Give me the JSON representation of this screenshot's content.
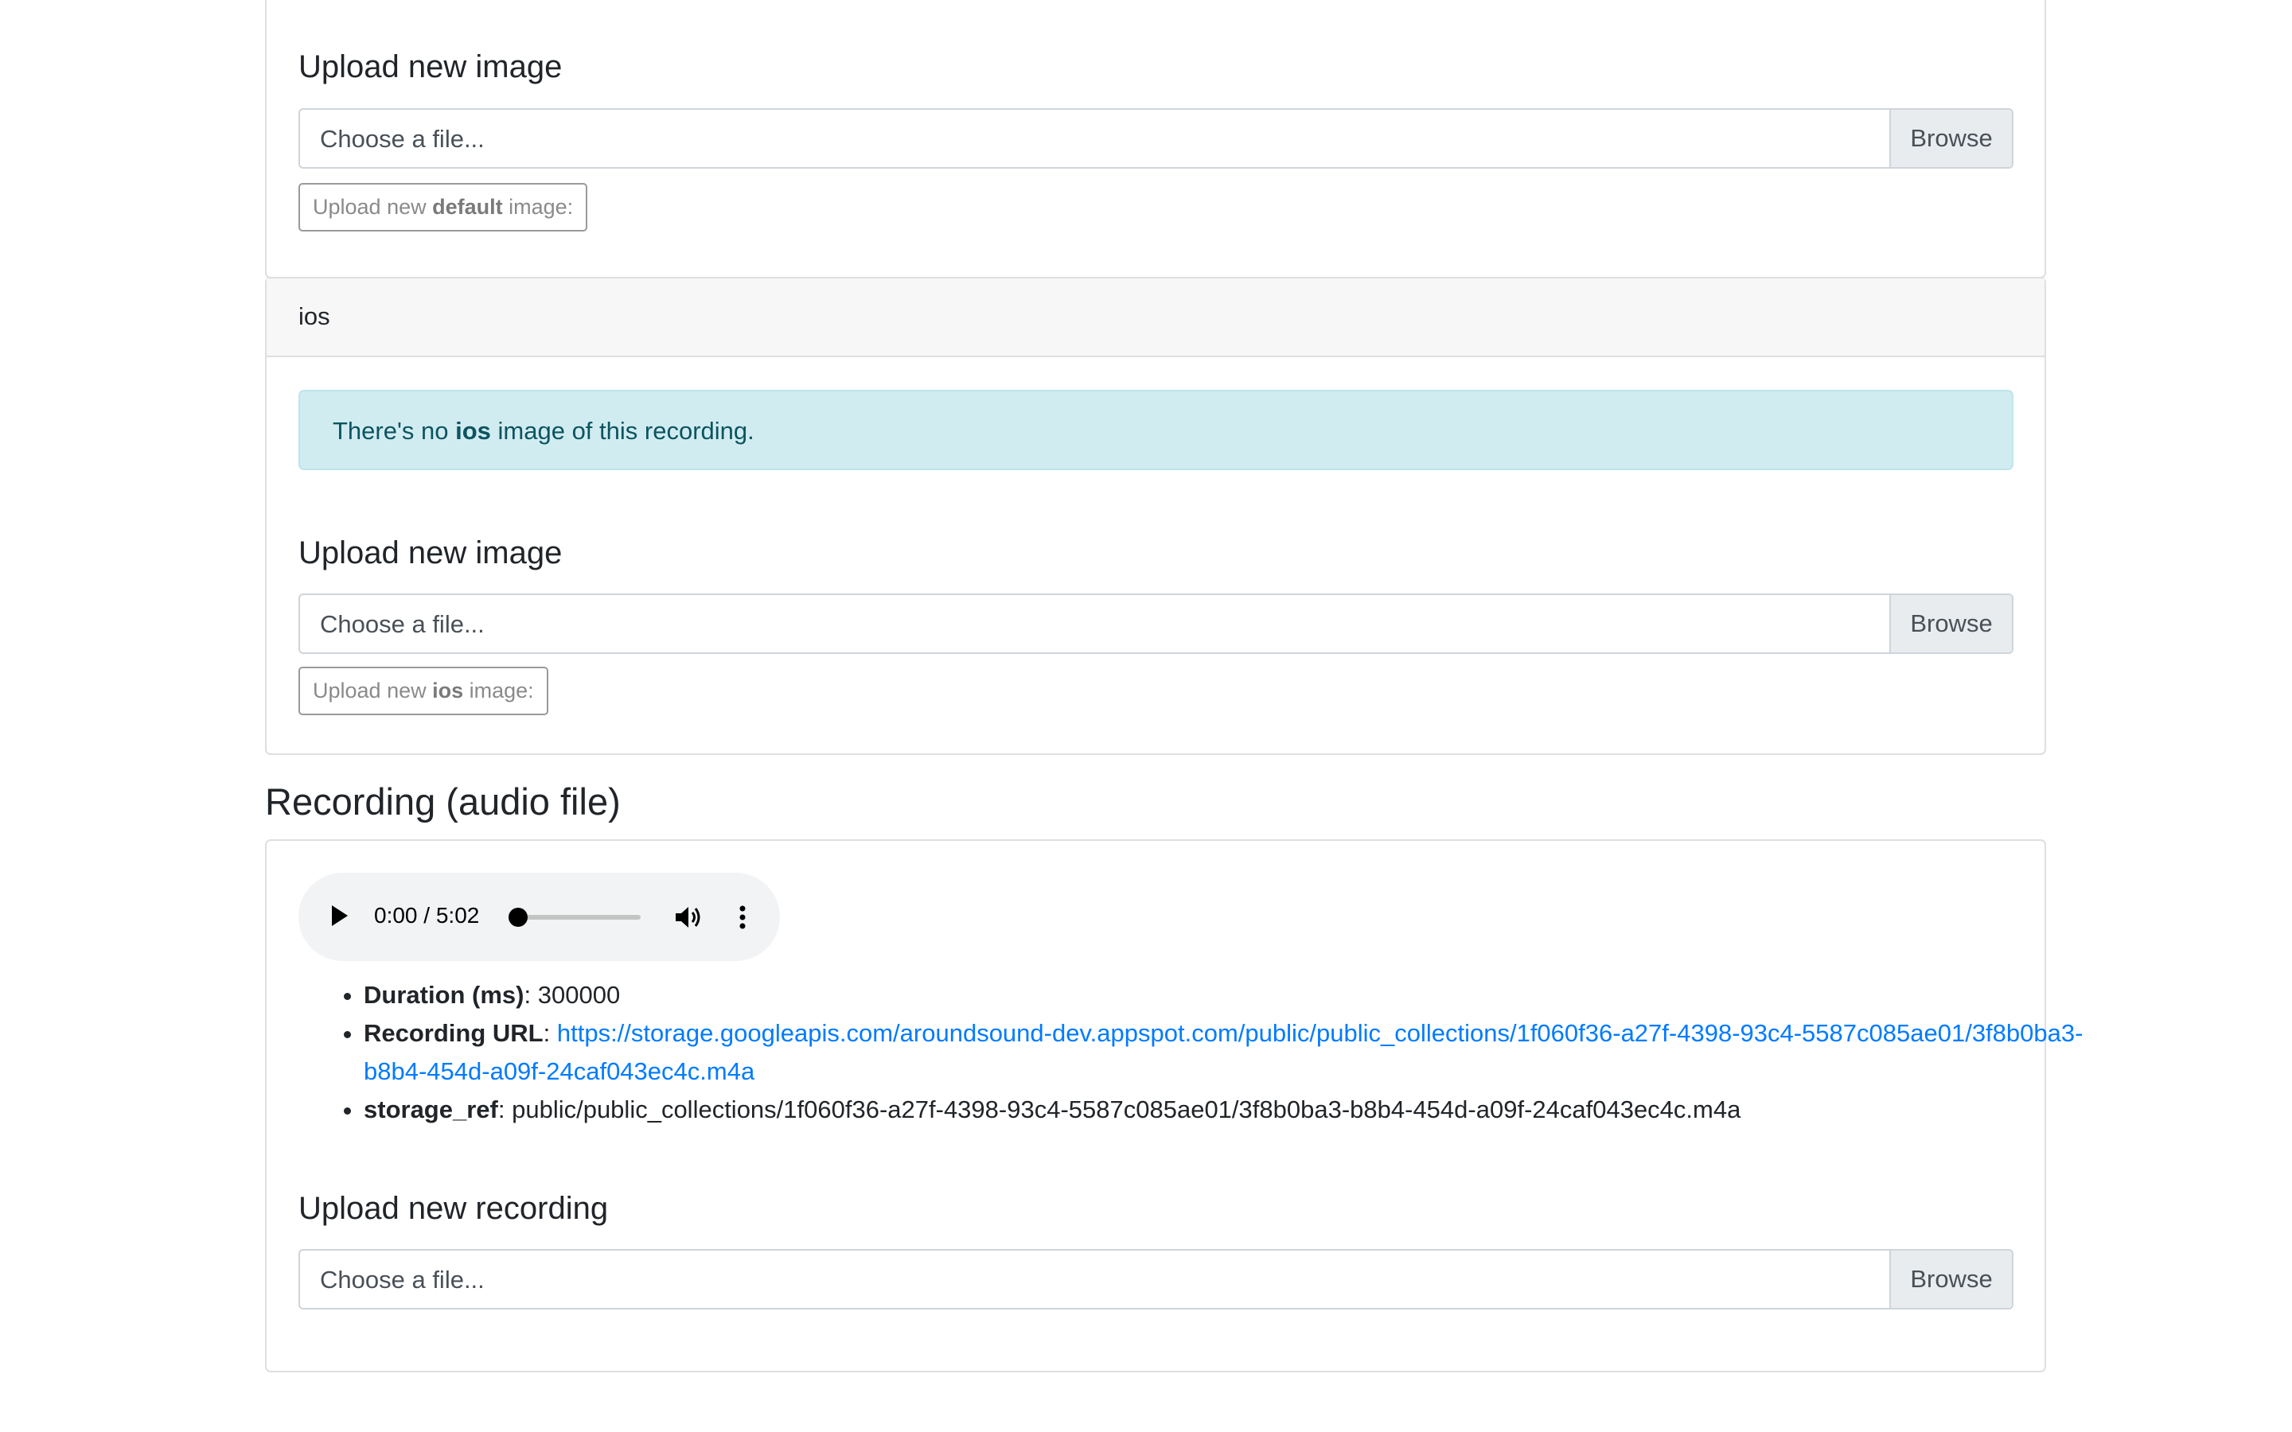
{
  "top_card": {
    "upload_heading": "Upload new image",
    "file_placeholder": "Choose a file...",
    "browse_label": "Browse",
    "upload_button": {
      "prefix": "Upload new ",
      "bold": "default",
      "suffix": " image:"
    }
  },
  "ios_card": {
    "header": "ios",
    "alert": {
      "prefix": "There's no ",
      "bold": "ios",
      "suffix": " image of this recording."
    },
    "upload_heading": "Upload new image",
    "file_placeholder": "Choose a file...",
    "browse_label": "Browse",
    "upload_button": {
      "prefix": "Upload new ",
      "bold": "ios",
      "suffix": " image:"
    }
  },
  "recording": {
    "title": "Recording (audio file)",
    "player": {
      "current_time": "0:00",
      "separator": "/",
      "duration": "5:02",
      "progress": 0
    },
    "details": [
      {
        "label": "Duration (ms)",
        "value": "300000"
      },
      {
        "label": "Recording URL",
        "link": "https://storage.googleapis.com/aroundsound-dev.appspot.com/public/public_collections/1f060f36-a27f-4398-93c4-5587c085ae01/3f8b0ba3-b8b4-454d-a09f-24caf043ec4c.m4a"
      },
      {
        "label": "storage_ref",
        "value": "public/public_collections/1f060f36-a27f-4398-93c4-5587c085ae01/3f8b0ba3-b8b4-454d-a09f-24caf043ec4c.m4a"
      }
    ],
    "upload_heading": "Upload new recording",
    "file_placeholder": "Choose a file...",
    "browse_label": "Browse"
  },
  "colors": {
    "link": "#007bff",
    "alert_bg": "#d1ecf1",
    "alert_text": "#0c5460"
  },
  "icons": [
    "play-icon",
    "volume-icon",
    "more-options-icon"
  ]
}
